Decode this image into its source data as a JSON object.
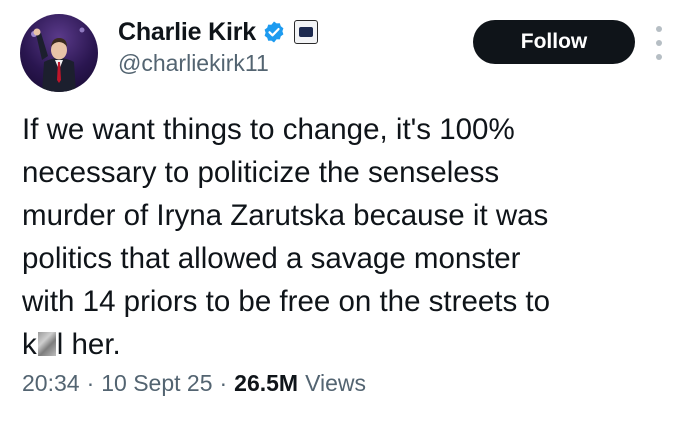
{
  "author": {
    "display_name": "Charlie Kirk",
    "handle": "@charliekirk11",
    "verified": true,
    "verified_color": "#1d9bf0"
  },
  "actions": {
    "follow_label": "Follow",
    "more_icon": "more-vertical-icon"
  },
  "tweet": {
    "lines": [
      "If we want things to change, it's 100%",
      "necessary to politicize the senseless",
      "murder of Iryna Zarutska because it was",
      "politics that allowed a savage monster",
      "with 14 priors to be free on the streets to"
    ],
    "last_line_prefix": "k",
    "last_line_suffix": "l her."
  },
  "meta": {
    "time": "20:34",
    "separator": "·",
    "date": "10 Sept 25",
    "views_count": "26.5M",
    "views_label": "Views"
  }
}
